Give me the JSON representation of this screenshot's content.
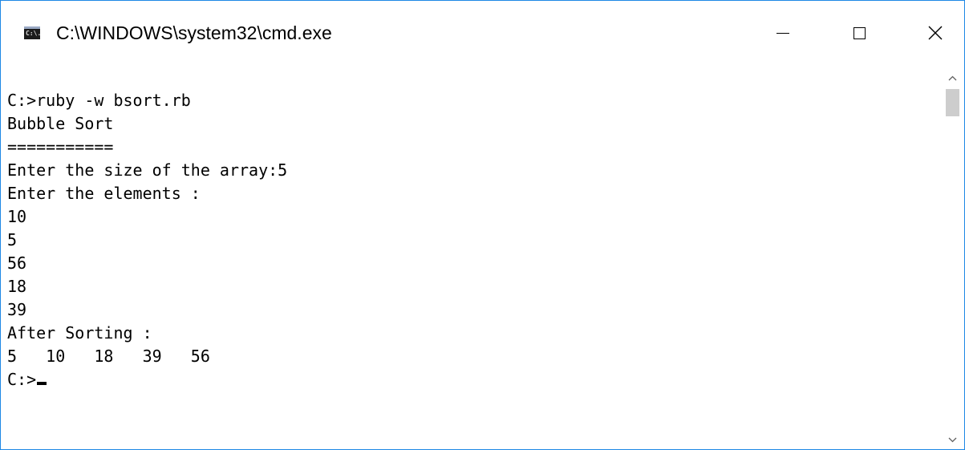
{
  "window": {
    "title": "C:\\WINDOWS\\system32\\cmd.exe",
    "icon": "cmd-console-icon",
    "icon_text": "C:\\.",
    "border_color": "#1e88e5"
  },
  "controls": {
    "minimize": "minimize-icon",
    "maximize": "maximize-icon",
    "close": "close-icon"
  },
  "console": {
    "lines": [
      "C:>ruby -w bsort.rb",
      "Bubble Sort",
      "===========",
      "Enter the size of the array:5",
      "Enter the elements :",
      "10",
      "5",
      "56",
      "18",
      "39",
      "After Sorting :",
      "5   10   18   39   56",
      "C:>"
    ]
  },
  "scrollbar": {
    "up_icon": "scroll-up-arrow-icon",
    "down_icon": "scroll-down-arrow-icon"
  }
}
